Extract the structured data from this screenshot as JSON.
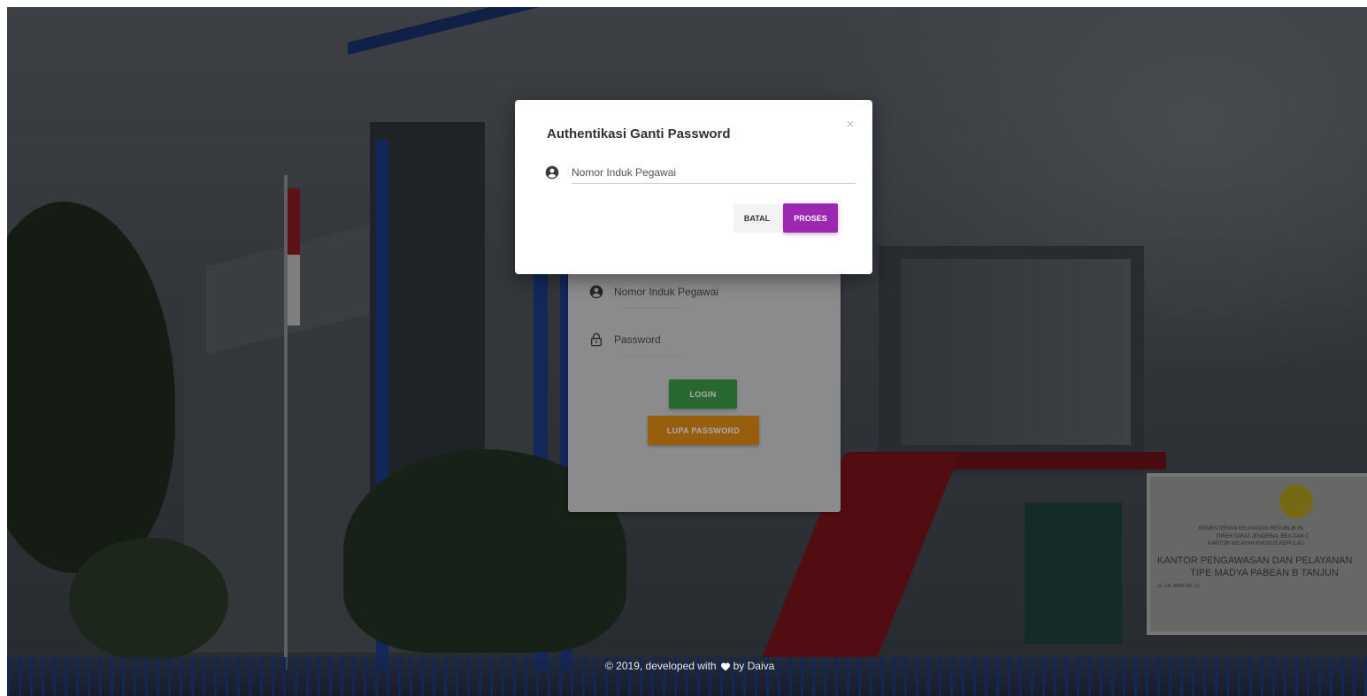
{
  "background": {
    "sign_lines": [
      "KEMENTERIAN KEUANGAN REPUBLIK IN",
      "DIREKTORAT JENDERAL BEA DAN C",
      "KANTOR WILAYAH KHUSUS KEPULAU",
      "KANTOR PENGAWASAN DAN PELAYANAN",
      "TIPE MADYA PABEAN B TANJUN",
      "JL. DR. AWIN NO. 11"
    ]
  },
  "login": {
    "nip_placeholder": "Nomor Induk Pegawai",
    "password_placeholder": "Password",
    "login_label": "LOGIN",
    "forgot_label": "LUPA PASSWORD"
  },
  "modal": {
    "title": "Authentikasi Ganti Password",
    "close_label": "×",
    "nip_placeholder": "Nomor Induk Pegawai",
    "nip_value": "",
    "cancel_label": "BATAL",
    "submit_label": "PROSES"
  },
  "footer": {
    "prefix": "© 2019, developed with",
    "suffix": "by Daiva"
  },
  "icons": {
    "user": "account-circle-icon",
    "lock": "lock-icon",
    "heart": "heart-icon",
    "close": "close-icon"
  },
  "colors": {
    "primary": "#9c27b0",
    "success": "#3d9a47",
    "warning": "#e28c14"
  }
}
